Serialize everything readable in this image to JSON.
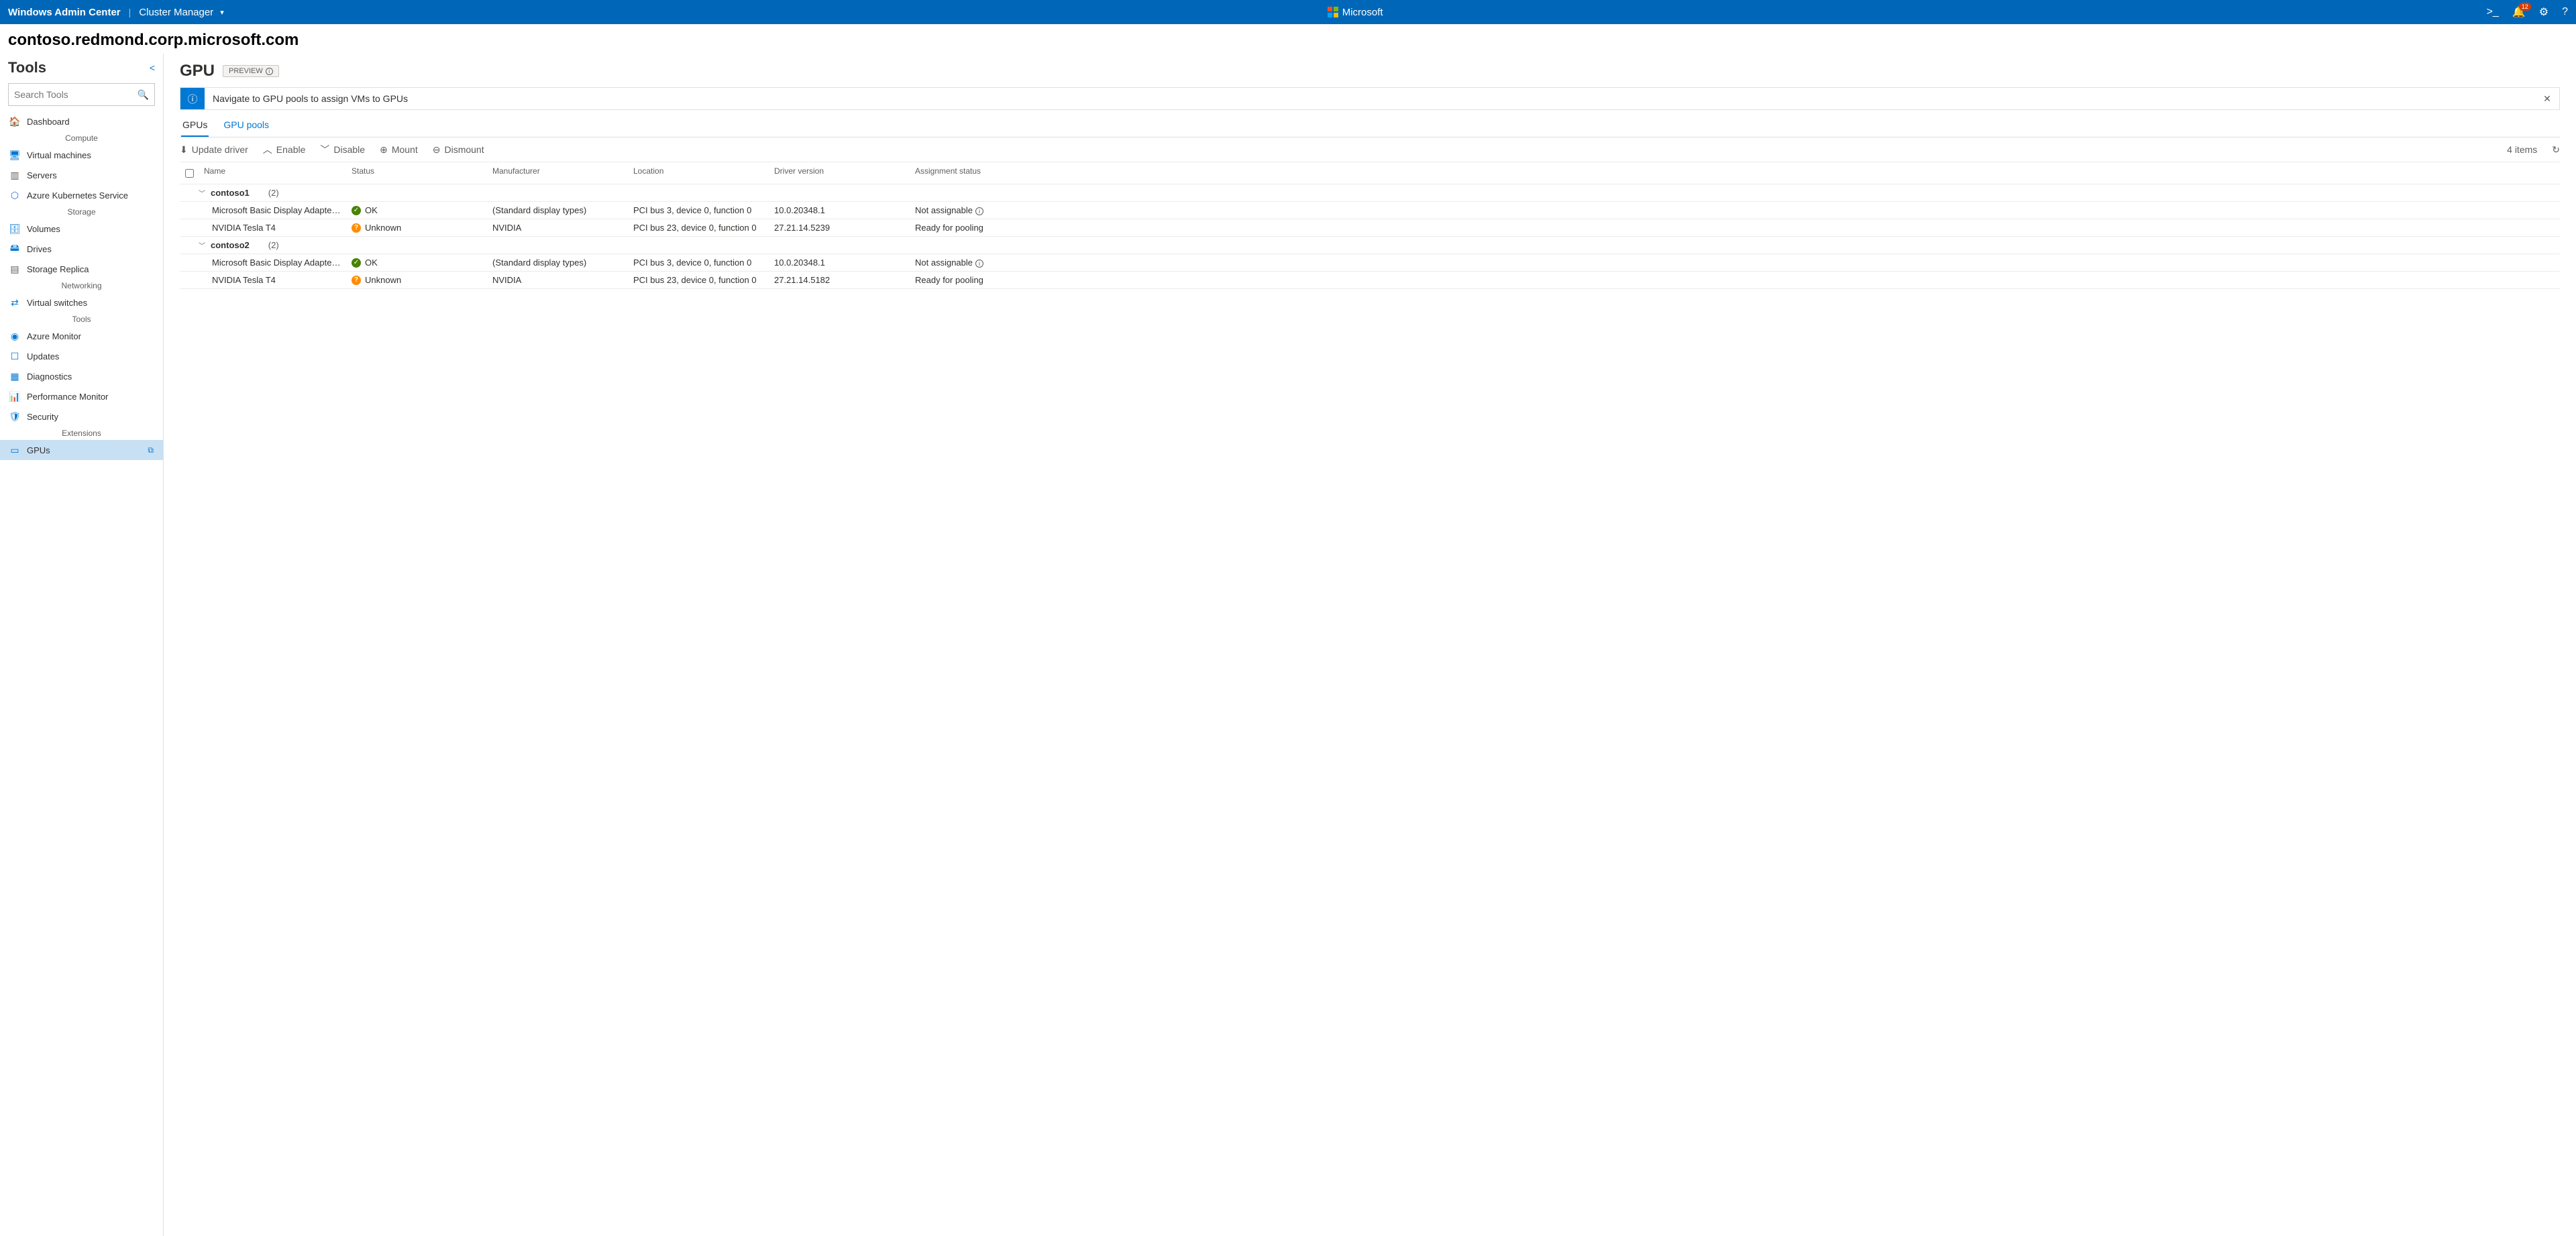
{
  "topbar": {
    "brand": "Windows Admin Center",
    "context": "Cluster Manager",
    "center_label": "Microsoft",
    "notif_count": "12"
  },
  "host": "contoso.redmond.corp.microsoft.com",
  "side": {
    "title": "Tools",
    "search_placeholder": "Search Tools",
    "categories": [
      {
        "label": "",
        "items": [
          {
            "label": "Dashboard",
            "icon": "🏠",
            "color": "#0078d4"
          }
        ]
      },
      {
        "label": "Compute",
        "items": [
          {
            "label": "Virtual machines",
            "icon": "🖥",
            "color": "#0078d4"
          },
          {
            "label": "Servers",
            "icon": "▥",
            "color": "#605e5c"
          },
          {
            "label": "Azure Kubernetes Service",
            "icon": "⬡",
            "color": "#326ce5"
          }
        ]
      },
      {
        "label": "Storage",
        "items": [
          {
            "label": "Volumes",
            "icon": "🗄",
            "color": "#0078d4"
          },
          {
            "label": "Drives",
            "icon": "🖴",
            "color": "#0078d4"
          },
          {
            "label": "Storage Replica",
            "icon": "▤",
            "color": "#605e5c"
          }
        ]
      },
      {
        "label": "Networking",
        "items": [
          {
            "label": "Virtual switches",
            "icon": "⇄",
            "color": "#0078d4"
          }
        ]
      },
      {
        "label": "Tools",
        "items": [
          {
            "label": "Azure Monitor",
            "icon": "◉",
            "color": "#0078d4"
          },
          {
            "label": "Updates",
            "icon": "☐",
            "color": "#0078d4"
          },
          {
            "label": "Diagnostics",
            "icon": "▦",
            "color": "#0078d4"
          },
          {
            "label": "Performance Monitor",
            "icon": "📊",
            "color": "#0078d4"
          },
          {
            "label": "Security",
            "icon": "🛡",
            "color": "#0078d4"
          }
        ]
      },
      {
        "label": "Extensions",
        "items": [
          {
            "label": "GPUs",
            "icon": "▭",
            "color": "#0078d4",
            "active": true,
            "ext": true
          }
        ]
      }
    ]
  },
  "page": {
    "title": "GPU",
    "preview": "PREVIEW",
    "banner": "Navigate to GPU pools to assign VMs to GPUs",
    "tabs": [
      "GPUs",
      "GPU pools"
    ],
    "active_tab": 0,
    "toolbar": {
      "update": "Update driver",
      "enable": "Enable",
      "disable": "Disable",
      "mount": "Mount",
      "dismount": "Dismount",
      "refresh_indicator": "↻",
      "count": "4 items"
    },
    "columns": [
      "Name",
      "Status",
      "Manufacturer",
      "Location",
      "Driver version",
      "Assignment status"
    ],
    "groups": [
      {
        "name": "contoso1",
        "count": "(2)",
        "rows": [
          {
            "name": "Microsoft Basic Display Adapter (Low Resolu…",
            "status": "OK",
            "statusKind": "ok",
            "manufacturer": "(Standard display types)",
            "location": "PCI bus 3, device 0, function 0",
            "driver": "10.0.20348.1",
            "assign": "Not assignable",
            "info": true
          },
          {
            "name": "NVIDIA Tesla T4",
            "status": "Unknown",
            "statusKind": "unk",
            "manufacturer": "NVIDIA",
            "location": "PCI bus 23, device 0, function 0",
            "driver": "27.21.14.5239",
            "assign": "Ready for pooling"
          }
        ]
      },
      {
        "name": "contoso2",
        "count": "(2)",
        "rows": [
          {
            "name": "Microsoft Basic Display Adapter (Low Resolu…",
            "status": "OK",
            "statusKind": "ok",
            "manufacturer": "(Standard display types)",
            "location": "PCI bus 3, device 0, function 0",
            "driver": "10.0.20348.1",
            "assign": "Not assignable",
            "info": true
          },
          {
            "name": "NVIDIA Tesla T4",
            "status": "Unknown",
            "statusKind": "unk",
            "manufacturer": "NVIDIA",
            "location": "PCI bus 23, device 0, function 0",
            "driver": "27.21.14.5182",
            "assign": "Ready for pooling"
          }
        ]
      }
    ]
  }
}
